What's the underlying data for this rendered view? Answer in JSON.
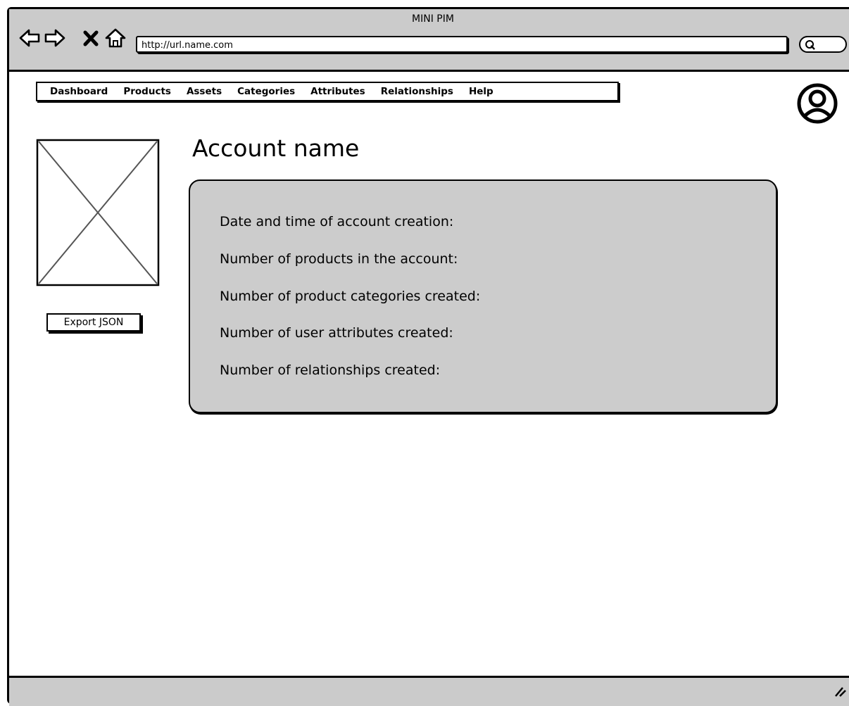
{
  "window": {
    "title": "MINI PIM"
  },
  "browser": {
    "url": "http://url.name.com",
    "icons": [
      "back-arrow-icon",
      "forward-arrow-icon",
      "close-icon",
      "home-icon",
      "search-icon"
    ]
  },
  "menu": {
    "items": [
      {
        "label": "Dashboard"
      },
      {
        "label": "Products"
      },
      {
        "label": "Assets"
      },
      {
        "label": "Categories"
      },
      {
        "label": "Attributes"
      },
      {
        "label": "Relationships"
      },
      {
        "label": "Help"
      }
    ]
  },
  "user": {
    "avatar_icon": "user-avatar-icon"
  },
  "sidebar": {
    "image_icon": "image-placeholder-icon",
    "export_label": "Export JSON"
  },
  "main": {
    "title": "Account name",
    "info_lines": [
      {
        "label": "Date and time of account creation:"
      },
      {
        "label": "Number of products in the account:"
      },
      {
        "label": "Number of product categories created:"
      },
      {
        "label": "Number of user attributes created:"
      },
      {
        "label": "Number of relationships created:"
      }
    ]
  },
  "colors": {
    "chrome": "#cbcbcb",
    "panel": "#cccccc",
    "ink": "#000000",
    "background": "#ffffff"
  }
}
